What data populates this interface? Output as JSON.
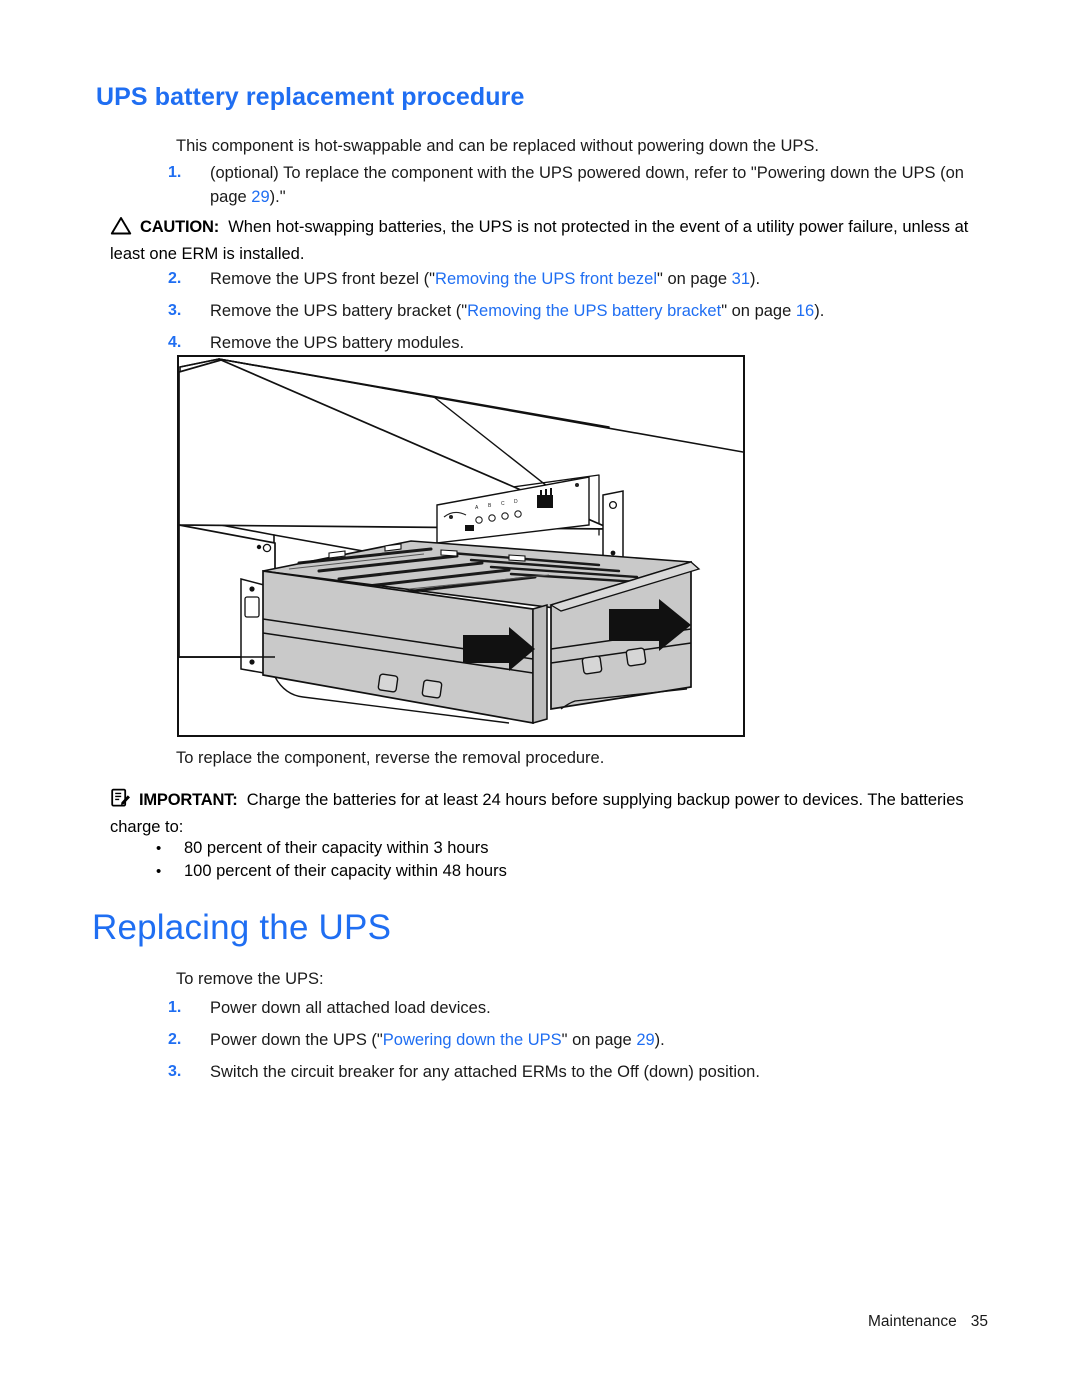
{
  "document": {
    "section_heading": "UPS battery replacement procedure",
    "chapter_heading": "Replacing the UPS"
  },
  "intro": {
    "text": "This component is hot-swappable and can be replaced without powering down the UPS."
  },
  "steps_battery": [
    {
      "num": "1.",
      "text_before": "(optional) To replace the component with the UPS powered down, refer to \"Powering down the UPS (on page ",
      "link": "",
      "page": "29",
      "text_after": ").\""
    },
    {
      "num": "2.",
      "text_before": "Remove the UPS front bezel (\"",
      "link": "Removing the UPS front bezel",
      "mid": "\" on page ",
      "page": "31",
      "text_after": ")."
    },
    {
      "num": "3.",
      "text_before": "Remove the UPS battery bracket (\"",
      "link": "Removing the UPS battery bracket",
      "mid": "\" on page ",
      "page": "16",
      "text_after": ")."
    },
    {
      "num": "4.",
      "text_before": "Remove the UPS battery modules.",
      "link": "",
      "mid": "",
      "page": "",
      "text_after": ""
    }
  ],
  "caution": {
    "icon": "warning-triangle-icon",
    "label": "CAUTION:",
    "text": "When hot-swapping batteries, the UPS is not protected in the event of a utility power failure, unless at least one ERM is installed."
  },
  "reverse_note": {
    "text": "To replace the component, reverse the removal procedure."
  },
  "important": {
    "icon": "notepad-pencil-icon",
    "label": "IMPORTANT:",
    "text": "Charge the batteries for at least 24 hours before supplying backup power to devices. The batteries charge to:"
  },
  "charge_bullets": [
    {
      "bullet": "•",
      "text": "80 percent of their capacity within 3 hours"
    },
    {
      "bullet": "•",
      "text": "100 percent of their capacity within 48 hours"
    }
  ],
  "replacing": {
    "intro": "To remove the UPS:"
  },
  "steps_replacing": [
    {
      "num": "1.",
      "text_before": "Power down all attached load devices.",
      "link": "",
      "mid": "",
      "page": "",
      "text_after": ""
    },
    {
      "num": "2.",
      "text_before": "Power down the UPS (\"",
      "link": "Powering down the UPS",
      "mid": "\" on page ",
      "page": "29",
      "text_after": ")."
    },
    {
      "num": "3.",
      "text_before": "Switch the circuit breaker for any attached ERMs to the Off (down) position.",
      "link": "",
      "mid": "",
      "page": "",
      "text_after": ""
    }
  ],
  "figure": {
    "caption": "",
    "alt_name": "ups-battery-module-removal-illustration"
  },
  "footer": {
    "chapter": "Maintenance",
    "page_number": "35"
  },
  "colors": {
    "heading_blue": "#1f6ef2",
    "link_blue": "#1f6ef2",
    "body_black": "#1a1a1a",
    "figure_border": "#111111",
    "module_fill": "#c9c9c9"
  }
}
